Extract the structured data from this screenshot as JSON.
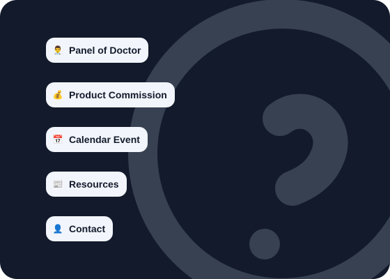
{
  "theme": {
    "background": "#121a2b",
    "decoration": "#384152",
    "item_background": "#f2f5fb",
    "item_text": "#121a2b"
  },
  "decoration": {
    "icon": "help-circle-icon"
  },
  "menu": {
    "items": [
      {
        "id": "panel-of-doctor",
        "icon": "doctor-icon",
        "glyph": "👨‍⚕️",
        "label": "Panel of Doctor"
      },
      {
        "id": "product-commission",
        "icon": "money-bag-icon",
        "glyph": "💰",
        "label": "Product Commission"
      },
      {
        "id": "calendar-event",
        "icon": "calendar-icon",
        "glyph": "📅",
        "label": "Calendar Event"
      },
      {
        "id": "resources",
        "icon": "newspaper-icon",
        "glyph": "📰",
        "label": "Resources"
      },
      {
        "id": "contact",
        "icon": "person-icon",
        "glyph": "👤",
        "label": "Contact"
      }
    ]
  }
}
